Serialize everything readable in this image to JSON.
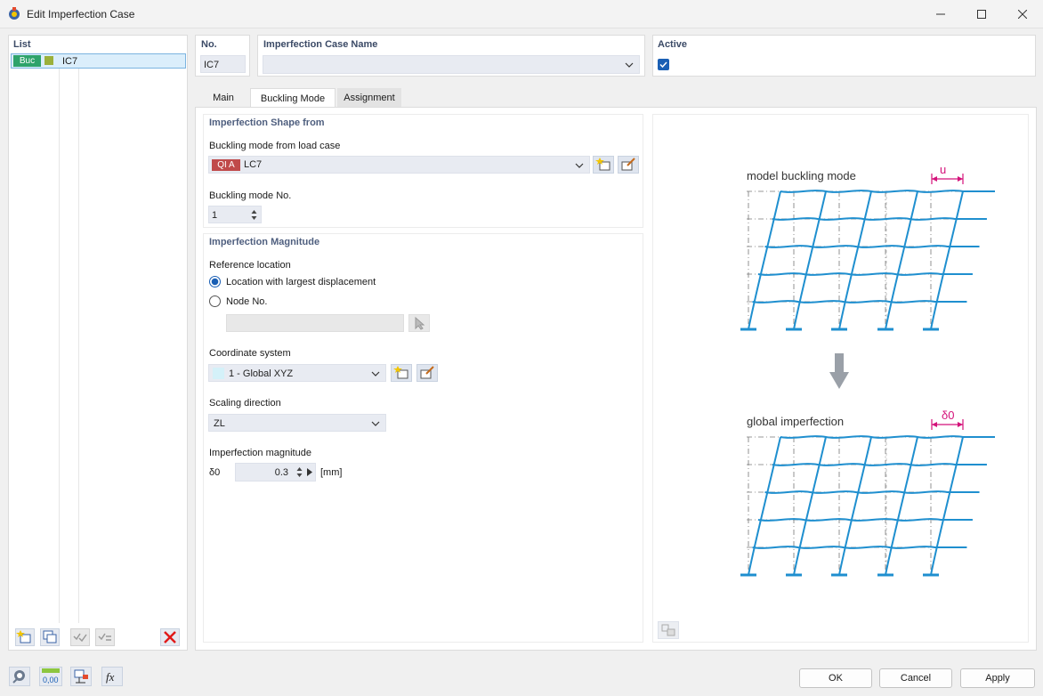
{
  "window": {
    "title": "Edit Imperfection Case"
  },
  "list": {
    "header": "List",
    "items": [
      {
        "tag": "Buc",
        "tag_color": "#2ea36b",
        "swatch_color": "#9bb03a",
        "name": "IC7"
      }
    ]
  },
  "no": {
    "label": "No.",
    "value": "IC7"
  },
  "name": {
    "label": "Imperfection Case Name",
    "value": ""
  },
  "active": {
    "label": "Active",
    "checked": true
  },
  "tabs": [
    {
      "label": "Main"
    },
    {
      "label": "Buckling Mode",
      "active": true
    },
    {
      "label": "Assignment"
    }
  ],
  "shape": {
    "header": "Imperfection Shape from",
    "load_case_label": "Buckling mode from load case",
    "load_case_tag": "QI A",
    "load_case_tag_color": "#c04a4a",
    "load_case_value": "LC7",
    "mode_no_label": "Buckling mode No.",
    "mode_no_value": "1"
  },
  "magnitude": {
    "header": "Imperfection Magnitude",
    "reference_label": "Reference location",
    "option_largest": "Location with largest displacement",
    "option_node": "Node No.",
    "node_value": "",
    "coord_label": "Coordinate system",
    "coord_value": "1 - Global XYZ",
    "coord_swatch_color": "#d4f1f9",
    "scaling_label": "Scaling direction",
    "scaling_value": "ZL",
    "magnitude_label": "Imperfection magnitude",
    "symbol": "δ0",
    "value": "0.3",
    "unit": "[mm]"
  },
  "figure": {
    "top_label": "model buckling mode",
    "top_dim": "u",
    "bottom_label": "global imperfection",
    "bottom_dim": "δ0",
    "frame_color": "#1f8fcf",
    "dim_color": "#d4127a"
  },
  "buttons": {
    "ok": "OK",
    "cancel": "Cancel",
    "apply": "Apply"
  }
}
